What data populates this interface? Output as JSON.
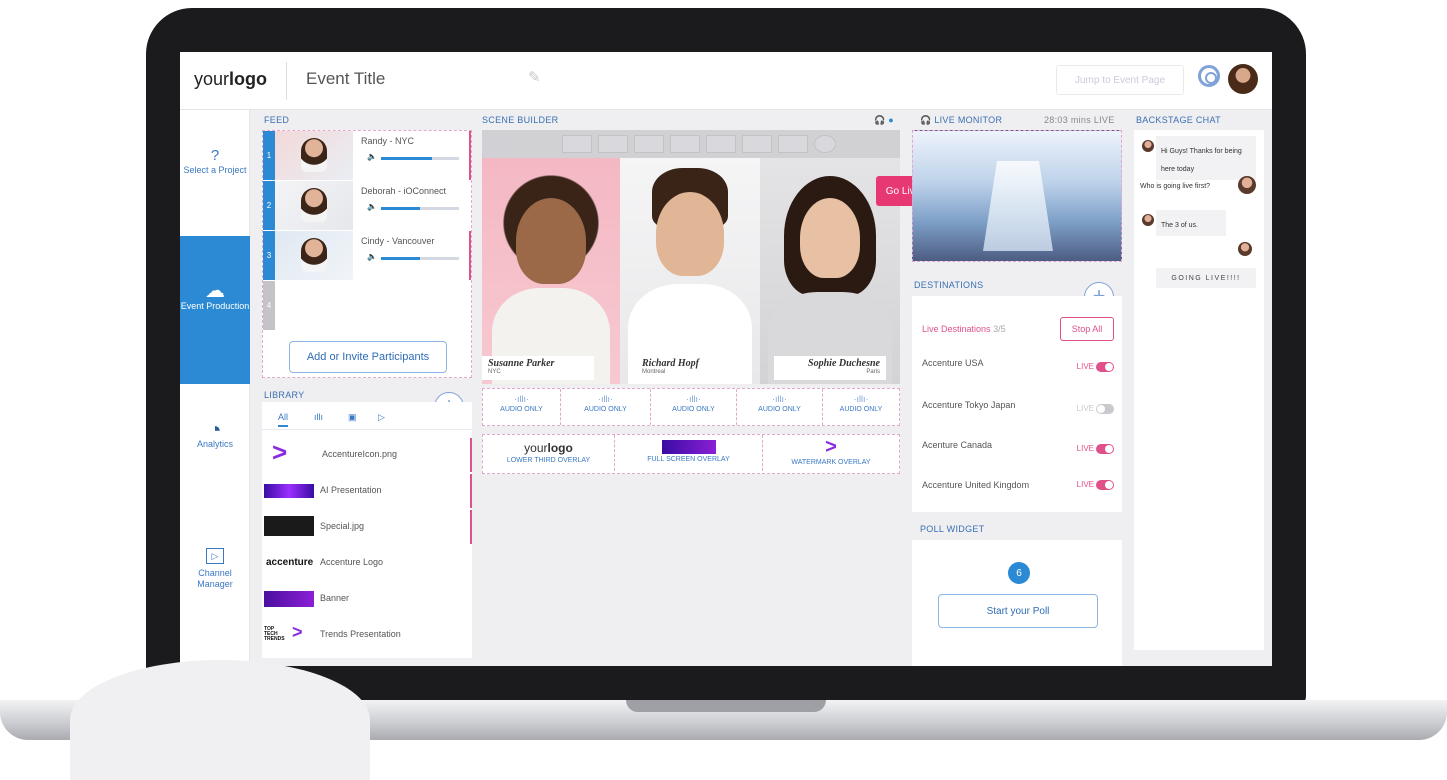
{
  "header": {
    "logo_prefix": "your",
    "logo_bold": "logo",
    "event_title": "Event Title",
    "jump_button": "Jump to Event Page"
  },
  "sidenav": [
    {
      "icon": "question-icon",
      "label": "Select a Project"
    },
    {
      "icon": "cloud-play-icon",
      "label": "Event Production"
    },
    {
      "icon": "pie-chart-icon",
      "label": "Analytics"
    },
    {
      "icon": "play-square-icon",
      "label": "Channel Manager"
    }
  ],
  "sections": {
    "feed": "FEED",
    "library": "LIBRARY",
    "scene_builder": "SCENE BUILDER",
    "live_monitor": "LIVE MONITOR",
    "live_timer": "28:03 mins LIVE",
    "backstage_chat": "BACKSTAGE CHAT",
    "destinations": "DESTINATIONS",
    "poll_widget": "POLL WIDGET"
  },
  "feed": {
    "rows": [
      {
        "num": "1",
        "name": "Randy - NYC",
        "volume": 0.65
      },
      {
        "num": "2",
        "name": "Deborah - iOConnect",
        "volume": 0.5
      },
      {
        "num": "3",
        "name": "Cindy - Vancouver",
        "volume": 0.5
      },
      {
        "num": "4",
        "name": "",
        "volume": 0
      }
    ],
    "invite_button": "Add or Invite Participants"
  },
  "library": {
    "tab_all": "All",
    "items": [
      {
        "name": "AccentureIcon.png"
      },
      {
        "name": "AI Presentation"
      },
      {
        "name": "Special.jpg"
      },
      {
        "name": "Accenture Logo"
      },
      {
        "name": "Banner"
      },
      {
        "name": "Trends Presentation"
      }
    ],
    "thumb_text": {
      "accenture": "accenture",
      "top_tech": "TOP TECH TRENDS"
    }
  },
  "scene": {
    "participants": [
      {
        "name": "Susanne Parker",
        "location": "NYC"
      },
      {
        "name": "Richard Hopf",
        "location": "Montreal"
      },
      {
        "name": "Sophie Duchesne",
        "location": "Paris"
      }
    ],
    "go_live": "Go Live",
    "audio_label": "AUDIO ONLY",
    "overlays": {
      "lower_third_logo_prefix": "your",
      "lower_third_logo_bold": "logo",
      "lower_third": "LOWER THIRD OVERLAY",
      "full_screen": "FULL SCREEN OVERLAY",
      "watermark": "WATERMARK OVERLAY"
    }
  },
  "destinations": {
    "live_label": "Live Destinations",
    "count": "3/5",
    "stop_all": "Stop All",
    "live_text": "LIVE",
    "items": [
      {
        "name": "Accenture USA",
        "live": true
      },
      {
        "name": "Accenture Tokyo Japan",
        "live": false
      },
      {
        "name": "Acenture Canada",
        "live": true
      },
      {
        "name": "Accenture United Kingdom",
        "live": true
      }
    ]
  },
  "poll": {
    "badge": "6",
    "start_button": "Start your Poll"
  },
  "chat": {
    "messages": [
      {
        "text": "Hi Guys! Thanks for being here today"
      },
      {
        "text": "Who is going live first?"
      },
      {
        "text": "The 3 of us."
      }
    ],
    "going_live": "GOING LIVE!!!!"
  },
  "colors": {
    "accent_blue": "#2c8ad4",
    "accent_pink": "#e0508a",
    "go_live": "#e73873"
  }
}
